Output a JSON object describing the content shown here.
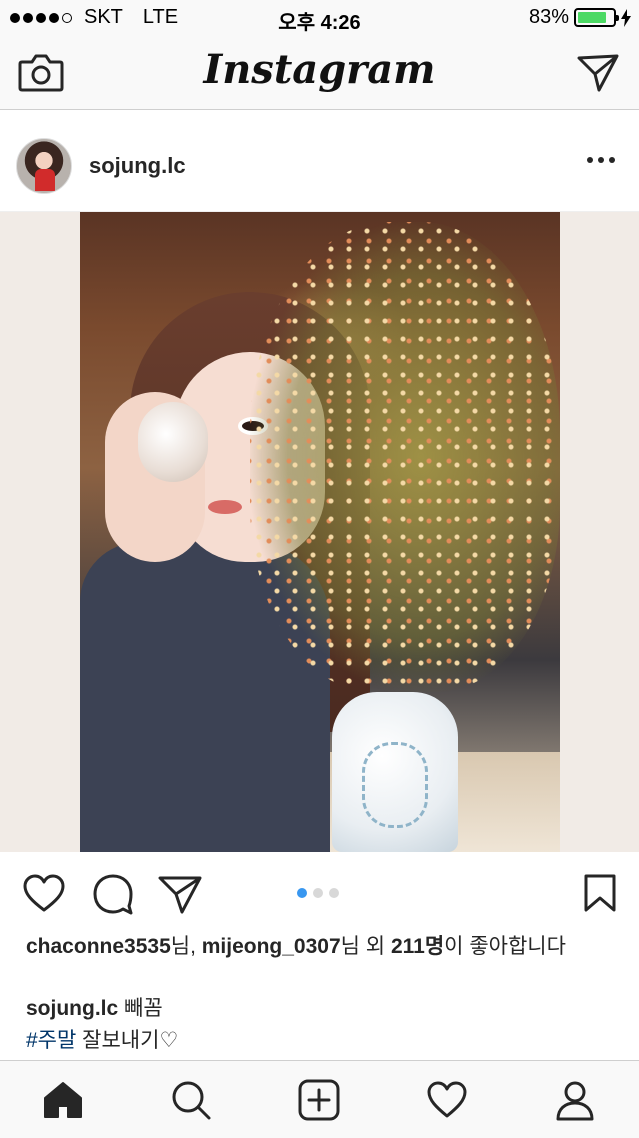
{
  "status_bar": {
    "carrier": "SKT",
    "network": "LTE",
    "time": "오후 4:26",
    "battery": "83%",
    "battery_level": 0.83,
    "signal_bars": 4,
    "signal_total": 5
  },
  "header": {
    "logo": "Instagram",
    "camera_icon": "camera-icon",
    "direct_icon": "paper-plane-icon"
  },
  "post": {
    "username": "sojung.lc",
    "more_icon": "more-horizontal-icon",
    "photo_alt": "sojung.lc photo",
    "carousel": {
      "count": 3,
      "active": 1
    },
    "likes": {
      "user1": "chaconne3535",
      "suffix1": "님, ",
      "user2": "mijeong_0307",
      "suffix2": "님 외 ",
      "count": "211명",
      "tail": "이 좋아합니다"
    },
    "caption": {
      "username": "sojung.lc",
      "text": " 빼꼼",
      "hashtag": "#주말",
      "after_hashtag": " 잘보내기♡"
    }
  },
  "actions": {
    "like_icon": "heart-icon",
    "comment_icon": "comment-icon",
    "share_icon": "paper-plane-icon",
    "save_icon": "bookmark-icon"
  },
  "tab_bar": {
    "items": [
      {
        "name": "home",
        "icon": "home-icon",
        "active": true
      },
      {
        "name": "search",
        "icon": "search-icon",
        "active": false
      },
      {
        "name": "add",
        "icon": "plus-square-icon",
        "active": false
      },
      {
        "name": "activity",
        "icon": "heart-icon",
        "active": false
      },
      {
        "name": "profile",
        "icon": "user-icon",
        "active": false
      }
    ]
  },
  "colors": {
    "accent": "#3897f0",
    "hashtag": "#003569",
    "battery": "#4cd964",
    "text": "#262626"
  }
}
